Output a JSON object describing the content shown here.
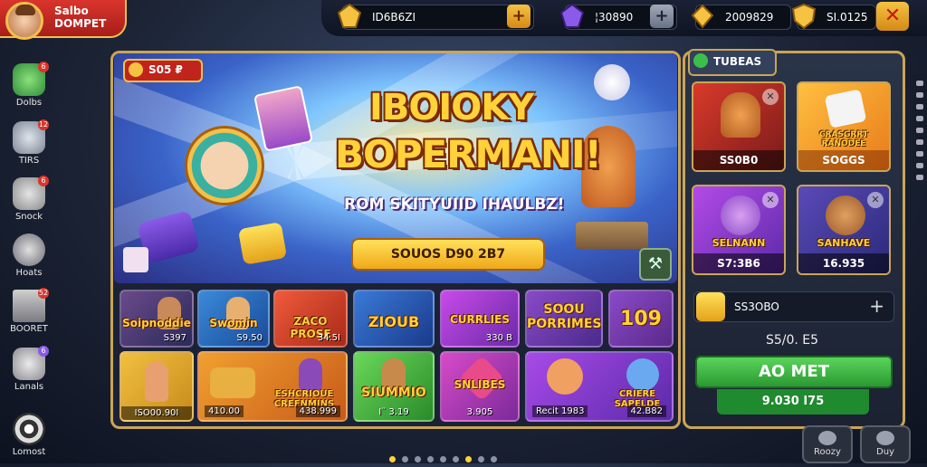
{
  "profile": {
    "name_line1": "Salbo",
    "name_line2": "DOMPET"
  },
  "currencies": [
    {
      "icon": "gold-gem-icon",
      "value": "ID6B6ZI",
      "has_plus": true
    },
    {
      "icon": "purple-gem-icon",
      "value": "¦30890",
      "has_plus": true
    },
    {
      "icon": "gold-crystal-icon",
      "value": "2009829"
    },
    {
      "icon": "gold-shield-icon",
      "value": "SI.0125"
    }
  ],
  "close_label": "✕",
  "left_nav": [
    {
      "label": "Dolbs",
      "badge": "6",
      "icon": "creature-icon"
    },
    {
      "label": "TIRS",
      "badge": "12",
      "icon": "bird-icon"
    },
    {
      "label": "Snock",
      "badge": "6",
      "icon": "rat-icon"
    },
    {
      "label": "Hoats",
      "badge": "",
      "icon": "shell-icon"
    },
    {
      "label": "BOORET",
      "badge": "52",
      "icon": "castle-icon"
    },
    {
      "label": "Lanals",
      "badge": "6",
      "icon": "cat-icon"
    },
    {
      "label": "Lomost",
      "badge": "",
      "icon": "target-icon"
    }
  ],
  "banner": {
    "tag": "S05 ₽",
    "title_line1": "IBOIOKY",
    "title_line2": "BOPERMANI!",
    "subtitle": "ROM SKITYUIID IHAULBZ!",
    "cta": "SOUOS D90 2B7"
  },
  "tiles_row1": [
    {
      "name": "Soipnoddie",
      "price": "S397"
    },
    {
      "name": "Swomin",
      "price": "S9.50"
    },
    {
      "name": "ZACO PROSE",
      "price": "34.5I"
    },
    {
      "name": "ZIOUB",
      "price": ""
    },
    {
      "name": "CURRLIES",
      "price": "330 B"
    },
    {
      "name": "SOOU PORRIMES",
      "price": ""
    },
    {
      "name": "109",
      "price": ""
    }
  ],
  "tiles_row2": [
    {
      "name": "",
      "price": "ISO00.90I"
    },
    {
      "name": "ESHCRIOUE CREFNMINS",
      "price": "410.00",
      "price2": "438.999"
    },
    {
      "name": "SIUMMIO",
      "price": "I¨ 3.19"
    },
    {
      "name": "SNLIBES",
      "price": "3.905"
    },
    {
      "name": "CRIERE SAPELDE",
      "price": "Recit 1983",
      "price2": "42.B82"
    }
  ],
  "right_panel": {
    "tab": "TUBEAS",
    "cards": [
      {
        "name": "",
        "price": "SS0B0",
        "has_close": true
      },
      {
        "name": "CRASGRRT RANODEE",
        "price": "SOGGS",
        "has_close": false
      },
      {
        "name": "SELNANN",
        "price": "S7:3B6",
        "has_close": true
      },
      {
        "name": "SANHAVE",
        "price": "16.935",
        "has_close": true
      }
    ],
    "balance": "SS3OBO",
    "subtotal": "S5/0. E5",
    "buy_label": "AO MET",
    "buy_sub": "9.030 I75"
  },
  "pager": {
    "count": 9,
    "active": [
      0,
      6
    ]
  },
  "bottom_buttons": [
    {
      "label": "Roozy"
    },
    {
      "label": "Duy"
    }
  ]
}
